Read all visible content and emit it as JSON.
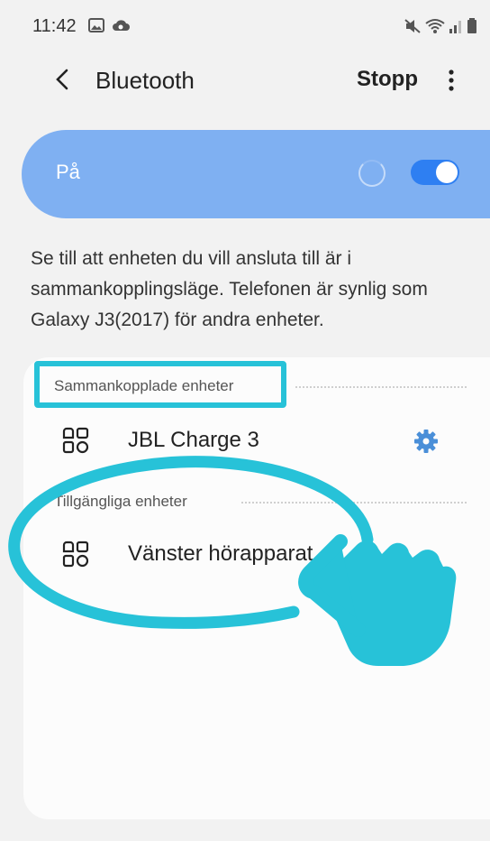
{
  "status_bar": {
    "time": "11:42",
    "left_icons": [
      "image-icon",
      "cloud-icon"
    ],
    "right_icons": [
      "mute-icon",
      "wifi-icon",
      "signal-icon",
      "battery-icon"
    ]
  },
  "header": {
    "title": "Bluetooth",
    "stop_label": "Stopp"
  },
  "bluetooth_toggle": {
    "label": "På",
    "enabled": true,
    "scanning": true,
    "accent_color": "#7fb0f2",
    "switch_color": "#2e7ff2"
  },
  "description": "Se till att enheten du vill ansluta till är i sammankopplingsläge. Telefonen är synlig som Galaxy J3(2017) för andra enheter.",
  "paired_section": {
    "header": "Sammankopplade enheter",
    "devices": [
      {
        "name": "JBL Charge 3",
        "icon": "device-grid-icon",
        "has_settings": true
      }
    ]
  },
  "available_section": {
    "header": "Tillgängliga enheter",
    "devices": [
      {
        "name": "Vänster hörapparat",
        "icon": "device-grid-icon"
      }
    ]
  },
  "annotations": {
    "highlight_color": "#27c2d8",
    "pointer": "hand-pointer-icon"
  }
}
